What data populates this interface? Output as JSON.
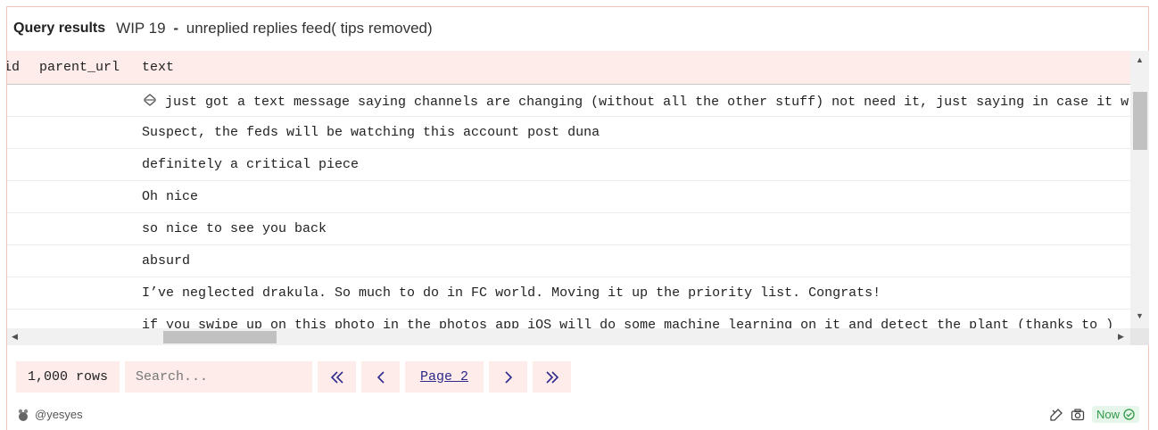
{
  "header": {
    "title": "Query results",
    "query_name_prefix": "WIP 19",
    "query_name_separator": "-",
    "query_name_suffix": "unreplied replies feed( tips removed)"
  },
  "table": {
    "columns": [
      "id",
      "parent_url",
      "text"
    ],
    "rows": [
      {
        "id": "",
        "parent_url": "",
        "text": "just got a text message saying channels are changing (without all the other stuff) not need it, just saying in case it w"
      },
      {
        "id": "",
        "parent_url": "",
        "text": "Suspect, the feds will be watching this account post duna"
      },
      {
        "id": "",
        "parent_url": "",
        "text": "definitely a critical piece"
      },
      {
        "id": "",
        "parent_url": "",
        "text": "Oh nice"
      },
      {
        "id": "",
        "parent_url": "",
        "text": "so nice to see you back"
      },
      {
        "id": "",
        "parent_url": "",
        "text": "absurd"
      },
      {
        "id": "",
        "parent_url": "",
        "text": "I’ve neglected drakula. So much to do in FC world. Moving it up the priority list. Congrats!"
      },
      {
        "id": "",
        "parent_url": "",
        "text": "if you swipe up on this photo in the photos app iOS will do some machine learning on it and detect the plant (thanks to )"
      }
    ]
  },
  "pager": {
    "rows_count": "1,000 rows",
    "search_placeholder": "Search...",
    "first_glyph": "≪",
    "prev_glyph": "‹",
    "page_label": "Page 2",
    "next_glyph": "›",
    "last_glyph": "≫"
  },
  "footer": {
    "author": "@yesyes",
    "status": "Now",
    "status_color": "#2f9a48"
  },
  "colors": {
    "accent_bg": "#fdecea",
    "border": "#f2c4bd",
    "nav": "#2d2a8c"
  }
}
